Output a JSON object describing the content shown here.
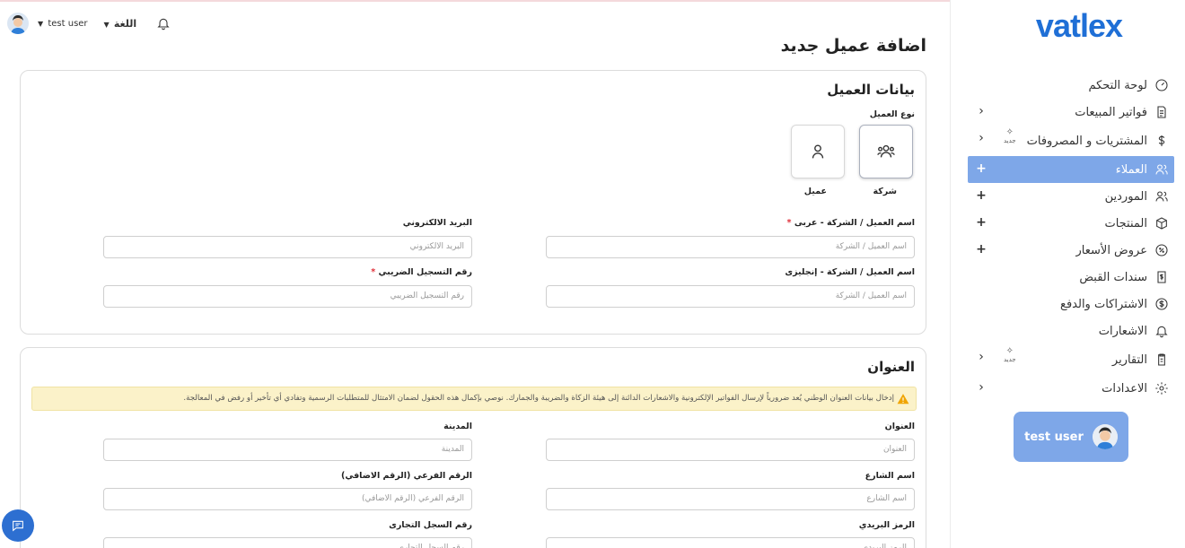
{
  "brand": {
    "logo_text": "vatlex",
    "accent": "#1f6fd6",
    "active_bg": "#7ea7e8"
  },
  "topbar": {
    "user_name": "test user",
    "language_label": "اللغة"
  },
  "page": {
    "title": "اضافة عميل جديد"
  },
  "sidebar": {
    "items": [
      {
        "label": "لوحة التحكم",
        "icon": "gauge-icon",
        "control": ""
      },
      {
        "label": "فواتير المبيعات",
        "icon": "invoice-icon",
        "control": "‹"
      },
      {
        "label": "المشتريات و المصروفات",
        "icon": "dollar-icon",
        "control": "‹",
        "badge": "جديد"
      },
      {
        "label": "العملاء",
        "icon": "users-icon",
        "control": "+",
        "active": true
      },
      {
        "label": "الموردين",
        "icon": "users-icon",
        "control": "+"
      },
      {
        "label": "المنتجات",
        "icon": "box-icon",
        "control": "+"
      },
      {
        "label": "عروض الأسعار",
        "icon": "percent-badge-icon",
        "control": "+"
      },
      {
        "label": "سندات القبض",
        "icon": "receipt-icon",
        "control": ""
      },
      {
        "label": "الاشتراكات والدفع",
        "icon": "coin-icon",
        "control": ""
      },
      {
        "label": "الاشعارات",
        "icon": "bell-icon",
        "control": ""
      },
      {
        "label": "التقارير",
        "icon": "clipboard-icon",
        "control": "‹",
        "badge": "جديد"
      },
      {
        "label": "الاعدادات",
        "icon": "gear-icon",
        "control": "‹"
      }
    ],
    "user_card": {
      "name": "test user"
    }
  },
  "customer": {
    "section_title": "بيانات العميل",
    "type_label": "نوع العميل",
    "type_company": "شركة",
    "type_person": "عميل",
    "fields": {
      "name_ar": {
        "label": "اسم العميل / الشركة - عربى",
        "placeholder": "اسم العميل  / الشركة"
      },
      "email": {
        "label": "البريد الالكتروني",
        "placeholder": "البريد الالكتروني"
      },
      "name_en": {
        "label": "اسم العميل / الشركة - إنجليزى",
        "placeholder": "اسم العميل  / الشركة"
      },
      "tax_no": {
        "label": "رقم التسجيل الضريبي",
        "placeholder": "رقم التسجيل  الضريبي"
      }
    },
    "required_mark": "*"
  },
  "address": {
    "section_title": "العنوان",
    "alert": "إدخال بيانات العنوان الوطني يُعد ضرورياً لإرسال الفواتير الإلكترونية والاشعارات الدائنة إلى هيئة الزكاة والضريبة والجمارك. نوصي بإكمال هذه الحقول لضمان الامتثال للمتطلبات الرسمية وتفادي أي تأخير أو رفض في المعالجة.",
    "fields": {
      "address": {
        "label": "العنوان",
        "placeholder": "العنوان"
      },
      "city": {
        "label": "المدينة",
        "placeholder": "المدينة"
      },
      "street": {
        "label": "اسم الشارع",
        "placeholder": "اسم الشارع"
      },
      "sub_no": {
        "label": "الرقم الفرعي (الرقم الاضافي)",
        "placeholder": "الرقم الفرعي (الرقم الاضافي)"
      },
      "postal": {
        "label": "الرمز البريدي",
        "placeholder": "الرمز البريدي"
      },
      "cr_no": {
        "label": "رقم السجل التجارى",
        "placeholder": "رقم السجل التجاري"
      }
    }
  }
}
